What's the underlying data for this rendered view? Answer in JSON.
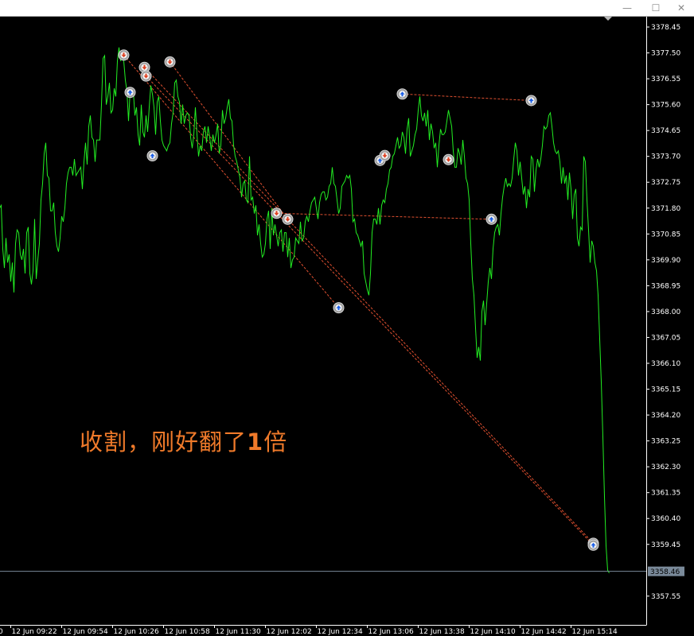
{
  "window": {
    "minimize_glyph": "—",
    "maximize_glyph": "☐",
    "close_glyph": "✕"
  },
  "annotation": {
    "text_before": "收割，刚好翻了",
    "text_bold": "1",
    "text_after": "倍"
  },
  "colors": {
    "background": "#000000",
    "price_line": "#22ee22",
    "buy_marker": "#1a5ee8",
    "sell_marker": "#e04020",
    "trade_line": "#e05030",
    "bid_line": "#7a8a9a",
    "annotation": "#f07a2a"
  },
  "chart_data": {
    "type": "line",
    "price_axis": {
      "ticks": [
        3378.45,
        3377.5,
        3376.55,
        3375.6,
        3374.65,
        3373.7,
        3372.75,
        3371.8,
        3370.85,
        3369.9,
        3368.95,
        3368.0,
        3367.05,
        3366.1,
        3365.15,
        3364.2,
        3363.25,
        3362.3,
        3361.35,
        3360.4,
        3359.45,
        3357.55
      ],
      "tick_labels": [
        "3378.45",
        "3377.50",
        "3376.55",
        "3375.60",
        "3374.65",
        "3373.70",
        "3372.75",
        "3371.80",
        "3370.85",
        "3369.90",
        "3368.95",
        "3368.00",
        "3367.05",
        "3366.10",
        "3365.15",
        "3364.20",
        "3363.25",
        "3362.30",
        "3361.35",
        "3360.40",
        "3359.45",
        "3357.55"
      ],
      "range": [
        3357.0,
        3379.0
      ]
    },
    "current_price": {
      "value": 3358.46,
      "label": "3358.46"
    },
    "time_axis": {
      "first_label": "0",
      "labels": [
        "12 Jun 09:22",
        "12 Jun 09:54",
        "12 Jun 10:26",
        "12 Jun 10:58",
        "12 Jun 11:30",
        "12 Jun 12:02",
        "12 Jun 12:34",
        "12 Jun 13:06",
        "12 Jun 13:38",
        "12 Jun 14:10",
        "12 Jun 14:42",
        "12 Jun 15:14"
      ],
      "minutes": [
        562,
        594,
        626,
        658,
        690,
        722,
        754,
        786,
        818,
        850,
        882,
        914
      ]
    },
    "price_series": {
      "name": "",
      "minutes": [
        517,
        518,
        519,
        520,
        521,
        522,
        523,
        524,
        525,
        526,
        527,
        528,
        529,
        530,
        531,
        532,
        533,
        534,
        535,
        536,
        537,
        538,
        539,
        540,
        541,
        542,
        543,
        544,
        545,
        546,
        547,
        548,
        549,
        550,
        551,
        552,
        553,
        554,
        555,
        556,
        557,
        558,
        559,
        560,
        561,
        562,
        563,
        564,
        565,
        566,
        567,
        568,
        569,
        570,
        571,
        572,
        573,
        574,
        575,
        576,
        577,
        578,
        579,
        580,
        581,
        582,
        583,
        584,
        585,
        586,
        587,
        588,
        589,
        590,
        591,
        592,
        593,
        594,
        595,
        596,
        597,
        598,
        599,
        600,
        601,
        602,
        603,
        604,
        605,
        606,
        607,
        608,
        609,
        610,
        611,
        612,
        613,
        614,
        615,
        616,
        617,
        618,
        619,
        620,
        621,
        622,
        623,
        624,
        625,
        626,
        627,
        628,
        629,
        630,
        631,
        632,
        633,
        634,
        635,
        636,
        637,
        638,
        639,
        640,
        641,
        642,
        643,
        644,
        645,
        646,
        647,
        648,
        649,
        650,
        651,
        652,
        653,
        654,
        655,
        656,
        657,
        658,
        659,
        660,
        661,
        662,
        663,
        664,
        665,
        666,
        667,
        668,
        669,
        670,
        671,
        672,
        673,
        674,
        675,
        676,
        677,
        678,
        679,
        680,
        681,
        682,
        683,
        684,
        685,
        686,
        687,
        688,
        689,
        690,
        691,
        692,
        693,
        694,
        695,
        696,
        697,
        698,
        699,
        700,
        701,
        702,
        703,
        704,
        705,
        706,
        707,
        708,
        709,
        710,
        711,
        712,
        713,
        714,
        715,
        716,
        717,
        718,
        719,
        720,
        721,
        722,
        723,
        724,
        725,
        726,
        727,
        728,
        729,
        730,
        731,
        732,
        733,
        734,
        735,
        736,
        737,
        738,
        739,
        740,
        741,
        742,
        743,
        744,
        745,
        746,
        747,
        748,
        749,
        750,
        751,
        752,
        753,
        754,
        755,
        756,
        757,
        758,
        759,
        760,
        761,
        762,
        763,
        764,
        765,
        766,
        767,
        768,
        769,
        770,
        771,
        772,
        773,
        774,
        775,
        776,
        777,
        778,
        779,
        780,
        781,
        782,
        783,
        784,
        785,
        786,
        787,
        788,
        789,
        790,
        791,
        792,
        793,
        794,
        795,
        796,
        797,
        798,
        799,
        800,
        801,
        802,
        803,
        804,
        805,
        806,
        807,
        808,
        809,
        810,
        811,
        812,
        813,
        814,
        815,
        816,
        817,
        818,
        819,
        820,
        821,
        822,
        823,
        824,
        825,
        826,
        827,
        828,
        829,
        830,
        831,
        832,
        833,
        834,
        835,
        836,
        837,
        838,
        839,
        840,
        841,
        842,
        843,
        844,
        845,
        846,
        847,
        848,
        849,
        850,
        851,
        852,
        853,
        854,
        855,
        856,
        857,
        858,
        859,
        860,
        861,
        862,
        863,
        864,
        865,
        866,
        867,
        868,
        869,
        870,
        871,
        872,
        873,
        874,
        875,
        876,
        877,
        878,
        879,
        880,
        881,
        882,
        883,
        884,
        885,
        886,
        887,
        888,
        889,
        890,
        891,
        892,
        893,
        894,
        895,
        896,
        897,
        898,
        899,
        900,
        901,
        902,
        903,
        904,
        905,
        906,
        907,
        908,
        909,
        910,
        911,
        912,
        913,
        914,
        915,
        916,
        917,
        918,
        919,
        920,
        921,
        922,
        923,
        924,
        925,
        926,
        927
      ],
      "prices": [
        3369.3,
        3371.2,
        3371.9,
        3370.5,
        3372.0,
        3371.3,
        3373.2,
        3373.5,
        3372.4,
        3372.2,
        3373.0,
        3374.5,
        3374.9,
        3376.0,
        3375.4,
        3374.8,
        3374.1,
        3372.9,
        3373.1,
        3374.1,
        3373.3,
        3372.8,
        3371.3,
        3370.2,
        3371.8,
        3371.9,
        3370.3,
        3369.6,
        3370.7,
        3369.8,
        3370.1,
        3369.1,
        3369.8,
        3368.7,
        3370.5,
        3371.0,
        3370.9,
        3370.1,
        3369.9,
        3370.3,
        3369.4,
        3370.9,
        3371.1,
        3369.4,
        3369.0,
        3369.5,
        3371.4,
        3369.2,
        3369.9,
        3370.5,
        3372.1,
        3372.7,
        3373.8,
        3374.2,
        3373.0,
        3372.9,
        3371.7,
        3371.7,
        3372.0,
        3370.9,
        3370.4,
        3370.2,
        3370.7,
        3371.5,
        3371.3,
        3371.8,
        3372.7,
        3373.1,
        3373.3,
        3373.3,
        3373.0,
        3373.6,
        3373.0,
        3373.1,
        3373.2,
        3373.3,
        3372.5,
        3373.5,
        3374.2,
        3373.4,
        3374.8,
        3375.2,
        3374.4,
        3374.3,
        3373.5,
        3374.3,
        3374.3,
        3374.3,
        3375.6,
        3377.3,
        3377.4,
        3375.6,
        3375.9,
        3376.4,
        3375.3,
        3375.4,
        3376.2,
        3375.9,
        3377.2,
        3377.7,
        3377.2,
        3377.5,
        3377.2,
        3376.5,
        3376.1,
        3375.0,
        3376.1,
        3375.9,
        3376.1,
        3375.2,
        3375.5,
        3374.5,
        3374.1,
        3375.6,
        3374.6,
        3374.4,
        3375.2,
        3374.6,
        3375.5,
        3376.3,
        3376.0,
        3375.5,
        3374.5,
        3375.7,
        3375.9,
        3375.0,
        3374.3,
        3374.1,
        3374.0,
        3373.9,
        3374.1,
        3374.2,
        3374.9,
        3375.3,
        3376.4,
        3376.5,
        3375.9,
        3375.7,
        3374.9,
        3375.6,
        3374.9,
        3375.2,
        3375.3,
        3375.2,
        3374.4,
        3374.0,
        3374.5,
        3375.5,
        3374.5,
        3373.7,
        3374.1,
        3373.9,
        3374.6,
        3374.8,
        3374.2,
        3374.8,
        3374.4,
        3373.9,
        3374.5,
        3374.2,
        3374.5,
        3374.9,
        3373.8,
        3374.1,
        3375.4,
        3374.9,
        3375.1,
        3375.5,
        3375.8,
        3375.1,
        3375.0,
        3374.1,
        3373.7,
        3373.5,
        3373.2,
        3372.9,
        3372.2,
        3372.7,
        3372.8,
        3372.1,
        3372.0,
        3373.7,
        3372.1,
        3372.2,
        3371.6,
        3371.9,
        3370.8,
        3371.2,
        3370.5,
        3370.0,
        3370.1,
        3370.5,
        3371.4,
        3371.7,
        3370.3,
        3371.8,
        3370.8,
        3371.2,
        3370.8,
        3370.4,
        3370.9,
        3371.0,
        3370.2,
        3370.9,
        3370.9,
        3370.0,
        3370.7,
        3369.6,
        3369.9,
        3370.0,
        3370.7,
        3370.6,
        3370.5,
        3371.3,
        3370.6,
        3370.7,
        3371.3,
        3371.5,
        3371.3,
        3371.7,
        3372.0,
        3372.1,
        3372.2,
        3371.8,
        3371.4,
        3372.0,
        3372.3,
        3372.4,
        3372.4,
        3372.1,
        3372.2,
        3372.6,
        3372.7,
        3373.3,
        3372.7,
        3372.6,
        3372.1,
        3371.6,
        3371.8,
        3372.6,
        3372.7,
        3372.8,
        3373.0,
        3372.9,
        3373.0,
        3372.5,
        3371.3,
        3371.4,
        3370.9,
        3370.8,
        3370.6,
        3370.4,
        3370.6,
        3369.4,
        3369.1,
        3368.8,
        3368.6,
        3369.4,
        3370.9,
        3371.4,
        3371.4,
        3371.2,
        3371.8,
        3371.2,
        3371.9,
        3372.1,
        3372.0,
        3372.5,
        3372.7,
        3373.2,
        3373.3,
        3373.7,
        3373.8,
        3374.1,
        3374.4,
        3374.0,
        3374.1,
        3374.6,
        3374.4,
        3373.8,
        3374.7,
        3375.1,
        3373.7,
        3373.9,
        3374.1,
        3374.5,
        3374.7,
        3375.4,
        3375.9,
        3375.2,
        3375.0,
        3375.3,
        3374.8,
        3375.4,
        3374.3,
        3374.9,
        3374.6,
        3374.0,
        3374.2,
        3373.3,
        3374.1,
        3374.7,
        3374.5,
        3374.5,
        3374.6,
        3375.0,
        3375.4,
        3375.1,
        3374.8,
        3373.9,
        3373.3,
        3373.3,
        3374.0,
        3373.8,
        3373.4,
        3374.3,
        3373.7,
        3372.9,
        3372.7,
        3372.1,
        3370.5,
        3369.2,
        3368.6,
        3367.4,
        3366.3,
        3366.7,
        3366.2,
        3368.0,
        3368.4,
        3367.5,
        3368.3,
        3369.1,
        3369.6,
        3369.2,
        3370.3,
        3370.9,
        3371.1,
        3371.2,
        3370.8,
        3371.6,
        3372.2,
        3372.6,
        3372.9,
        3372.6,
        3372.7,
        3372.6,
        3372.9,
        3373.6,
        3374.2,
        3373.9,
        3373.0,
        3373.5,
        3372.9,
        3372.3,
        3372.6,
        3371.8,
        3372.5,
        3372.2,
        3373.7,
        3373.6,
        3372.4,
        3373.2,
        3373.6,
        3373.3,
        3373.6,
        3374.1,
        3374.8,
        3374.7,
        3374.8,
        3375.2,
        3375.3,
        3374.8,
        3374.2,
        3373.9,
        3373.8,
        3373.9,
        3373.5,
        3372.7,
        3373.3,
        3372.7,
        3373.0,
        3372.1,
        3373.1,
        3372.5,
        3371.4,
        3372.3,
        3372.5,
        3370.7,
        3370.4,
        3371.1,
        3371.0,
        3373.7,
        3373.5,
        3372.1,
        3371.0,
        3369.8,
        3370.6,
        3370.4,
        3369.8,
        3369.5,
        3368.6,
        3367.0,
        3365.4,
        3363.4,
        3361.2,
        3359.4,
        3358.5,
        3358.4
      ]
    },
    "trades": [
      {
        "entry": {
          "minute": 619,
          "price": 3377.42,
          "side": "sell"
        },
        "exit": {
          "minute": 754,
          "price": 3368.14,
          "side": "buy"
        }
      },
      {
        "entry": {
          "minute": 632,
          "price": 3376.97,
          "side": "sell"
        },
        "exit": {
          "minute": 914,
          "price": 3359.49,
          "side": "buy"
        }
      },
      {
        "entry": {
          "minute": 633,
          "price": 3376.65,
          "side": "sell"
        },
        "exit": {
          "minute": 914,
          "price": 3359.42,
          "side": "buy"
        }
      },
      {
        "entry": {
          "minute": 648,
          "price": 3377.17,
          "side": "sell"
        },
        "exit": {
          "minute": 722,
          "price": 3371.39,
          "side": "sell"
        }
      },
      {
        "entry": {
          "minute": 715,
          "price": 3371.61,
          "side": "sell"
        },
        "exit": {
          "minute": 850,
          "price": 3371.39,
          "side": "buy"
        }
      },
      {
        "entry": {
          "minute": 794,
          "price": 3375.99,
          "side": "buy"
        },
        "exit": {
          "minute": 875,
          "price": 3375.75,
          "side": "buy"
        }
      }
    ],
    "extra_markers": [
      {
        "minute": 623,
        "price": 3376.05,
        "side": "buy"
      },
      {
        "minute": 637,
        "price": 3373.72,
        "side": "buy"
      },
      {
        "minute": 780,
        "price": 3373.55,
        "side": "buy"
      },
      {
        "minute": 783,
        "price": 3373.73,
        "side": "sell"
      },
      {
        "minute": 823,
        "price": 3373.58,
        "side": "sell"
      }
    ]
  }
}
